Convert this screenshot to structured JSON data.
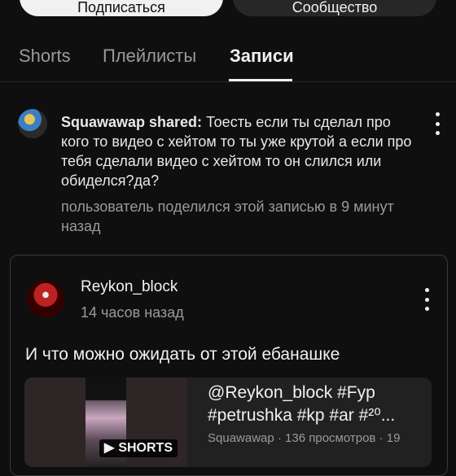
{
  "top_buttons": {
    "subscribe_label": "Подписаться",
    "community_label": "Сообщество"
  },
  "tabs": [
    {
      "label": "Shorts"
    },
    {
      "label": "Плейлисты"
    },
    {
      "label": "Записи",
      "active": true
    }
  ],
  "shared_post": {
    "author": "Squawawap shared:",
    "text": "Тоесть если ты сделал про кого то видео с хейтом то ты уже крутой а если про тебя сделали видео с хейтом то он слился или обиделся?да?",
    "meta": "пользователь поделился этой записью в 9 минут назад"
  },
  "original_post": {
    "author": "Reykon_block",
    "time": "14 часов назад",
    "text": "И что можно ожидать от этой ебанашке",
    "video": {
      "badge": "SHORTS",
      "title": "@Reykon_block #Fyp #petrushka #kp #ar #²⁰...",
      "meta": "Squawawap · 136 просмотров · 19"
    }
  },
  "icons": {
    "kebab": "more-vert-icon",
    "shorts": "shorts-icon",
    "community": "community-icon"
  }
}
